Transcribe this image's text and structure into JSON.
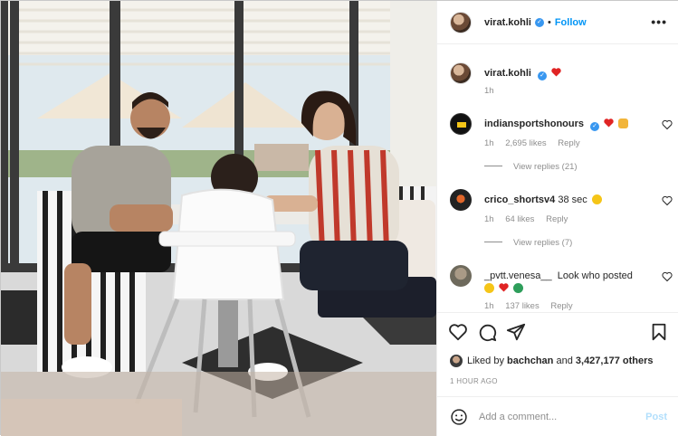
{
  "post": {
    "username": "virat.kohli",
    "follow_label": "Follow",
    "separator": "•",
    "more_label": "•••"
  },
  "caption": {
    "username": "virat.kohli",
    "time": "1h"
  },
  "comments": [
    {
      "username": "indiansportshonours",
      "text": "",
      "time": "1h",
      "likes": "2,695 likes",
      "reply_label": "Reply",
      "view_replies": "View replies (21)"
    },
    {
      "username": "crico_shortsv4",
      "text": "38 sec",
      "time": "1h",
      "likes": "64 likes",
      "reply_label": "Reply",
      "view_replies": "View replies (7)"
    },
    {
      "username": "_pvtt.venesa__",
      "text": "Look who posted",
      "time": "1h",
      "likes": "137 likes",
      "reply_label": "Reply"
    }
  ],
  "likes": {
    "prefix": "Liked by",
    "liker": "bachchan",
    "middle": "and",
    "others": "3,427,177 others"
  },
  "timestamp": "1 HOUR AGO",
  "add_comment": {
    "placeholder": "Add a comment...",
    "post_label": "Post"
  },
  "colors": {
    "accent": "#0095f6",
    "post_disabled": "#b2dffc",
    "verified": "#3897f0",
    "muted": "#8e8e8e",
    "heart": "#ed4956"
  },
  "icons": [
    "verified-badge-icon",
    "more-options-icon",
    "red-heart-emoji-icon",
    "praying-hands-emoji-icon",
    "sunglasses-emoji-icon",
    "heart-outline-icon",
    "comment-icon",
    "share-icon",
    "bookmark-icon",
    "smiley-icon"
  ]
}
